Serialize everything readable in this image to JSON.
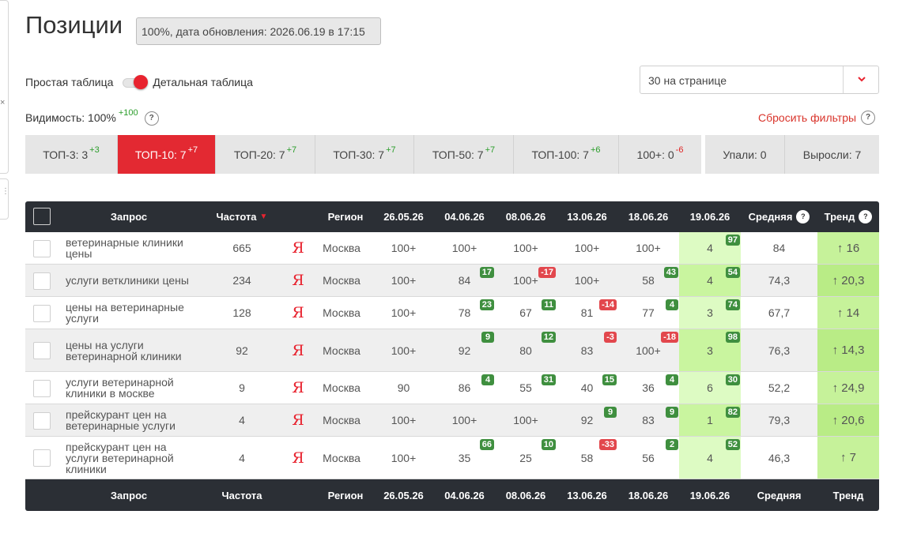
{
  "page": {
    "title": "Позиции",
    "update_status": "100%, дата обновления: 2026.06.19 в 17:15"
  },
  "view_toggle": {
    "simple_label": "Простая таблица",
    "detailed_label": "Детальная таблица",
    "active": "detailed"
  },
  "per_page": {
    "label": "30 на странице"
  },
  "visibility": {
    "label": "Видимость: 100%",
    "delta": "+100"
  },
  "reset_filters": {
    "label": "Сбросить фильтры"
  },
  "tabs": [
    {
      "label": "ТОП-3: 3",
      "delta": "+3",
      "sign": "pos",
      "active": false
    },
    {
      "label": "ТОП-10: 7",
      "delta": "+7",
      "sign": "pos",
      "active": true
    },
    {
      "label": "ТОП-20: 7",
      "delta": "+7",
      "sign": "pos",
      "active": false
    },
    {
      "label": "ТОП-30: 7",
      "delta": "+7",
      "sign": "pos",
      "active": false
    },
    {
      "label": "ТОП-50: 7",
      "delta": "+7",
      "sign": "pos",
      "active": false
    },
    {
      "label": "ТОП-100: 7",
      "delta": "+6",
      "sign": "pos",
      "active": false
    },
    {
      "label": "100+: 0",
      "delta": "-6",
      "sign": "neg",
      "active": false
    }
  ],
  "change_tabs": [
    {
      "label": "Упали: 0"
    },
    {
      "label": "Выросли: 7"
    }
  ],
  "table": {
    "headers": {
      "query": "Запрос",
      "frequency": "Частота",
      "region": "Регион",
      "dates": [
        "26.05.26",
        "04.06.26",
        "08.06.26",
        "13.06.26",
        "18.06.26",
        "19.06.26"
      ],
      "average": "Средняя",
      "trend": "Тренд"
    },
    "search_engine_glyph": "Я",
    "rows": [
      {
        "query": "ветеринарные клиники цены",
        "frequency": "665",
        "region": "Москва",
        "positions": [
          {
            "value": "100+",
            "delta": ""
          },
          {
            "value": "100+",
            "delta": ""
          },
          {
            "value": "100+",
            "delta": ""
          },
          {
            "value": "100+",
            "delta": ""
          },
          {
            "value": "100+",
            "delta": ""
          },
          {
            "value": "4",
            "delta": "97"
          }
        ],
        "average": "84",
        "trend": "↑ 16"
      },
      {
        "query": "услуги ветклиники цены",
        "frequency": "234",
        "region": "Москва",
        "positions": [
          {
            "value": "100+",
            "delta": ""
          },
          {
            "value": "84",
            "delta": "17"
          },
          {
            "value": "100+",
            "delta": "-17"
          },
          {
            "value": "100+",
            "delta": ""
          },
          {
            "value": "58",
            "delta": "43"
          },
          {
            "value": "4",
            "delta": "54"
          }
        ],
        "average": "74,3",
        "trend": "↑ 20,3"
      },
      {
        "query": "цены на ветеринарные услуги",
        "frequency": "128",
        "region": "Москва",
        "positions": [
          {
            "value": "100+",
            "delta": ""
          },
          {
            "value": "78",
            "delta": "23"
          },
          {
            "value": "67",
            "delta": "11"
          },
          {
            "value": "81",
            "delta": "-14"
          },
          {
            "value": "77",
            "delta": "4"
          },
          {
            "value": "3",
            "delta": "74"
          }
        ],
        "average": "67,7",
        "trend": "↑ 14"
      },
      {
        "query": "цены на услуги ветеринарной клиники",
        "frequency": "92",
        "region": "Москва",
        "positions": [
          {
            "value": "100+",
            "delta": ""
          },
          {
            "value": "92",
            "delta": "9"
          },
          {
            "value": "80",
            "delta": "12"
          },
          {
            "value": "83",
            "delta": "-3"
          },
          {
            "value": "100+",
            "delta": "-18"
          },
          {
            "value": "3",
            "delta": "98"
          }
        ],
        "average": "76,3",
        "trend": "↑ 14,3"
      },
      {
        "query": "услуги ветеринарной клиники в москве",
        "frequency": "9",
        "region": "Москва",
        "positions": [
          {
            "value": "90",
            "delta": ""
          },
          {
            "value": "86",
            "delta": "4"
          },
          {
            "value": "55",
            "delta": "31"
          },
          {
            "value": "40",
            "delta": "15"
          },
          {
            "value": "36",
            "delta": "4"
          },
          {
            "value": "6",
            "delta": "30"
          }
        ],
        "average": "52,2",
        "trend": "↑ 24,9"
      },
      {
        "query": "прейскурант цен на ветеринарные услуги",
        "frequency": "4",
        "region": "Москва",
        "positions": [
          {
            "value": "100+",
            "delta": ""
          },
          {
            "value": "100+",
            "delta": ""
          },
          {
            "value": "100+",
            "delta": ""
          },
          {
            "value": "92",
            "delta": "9"
          },
          {
            "value": "83",
            "delta": "9"
          },
          {
            "value": "1",
            "delta": "82"
          }
        ],
        "average": "79,3",
        "trend": "↑ 20,6"
      },
      {
        "query": "прейскурант цен на услуги ветеринарной клиники",
        "frequency": "4",
        "region": "Москва",
        "positions": [
          {
            "value": "100+",
            "delta": ""
          },
          {
            "value": "35",
            "delta": "66"
          },
          {
            "value": "25",
            "delta": "10"
          },
          {
            "value": "58",
            "delta": "-33"
          },
          {
            "value": "56",
            "delta": "2"
          },
          {
            "value": "4",
            "delta": "52"
          }
        ],
        "average": "46,3",
        "trend": "↑ 7"
      }
    ]
  },
  "icons": {
    "help": "?",
    "close": "×",
    "sort_desc": "⌄"
  }
}
